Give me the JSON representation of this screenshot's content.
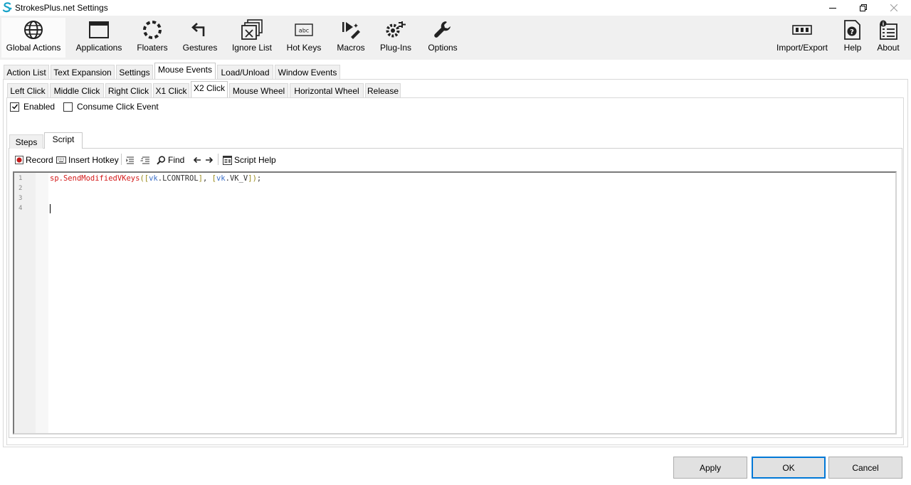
{
  "window": {
    "title": "StrokesPlus.net Settings"
  },
  "toolbar": {
    "global_actions": "Global Actions",
    "applications": "Applications",
    "floaters": "Floaters",
    "gestures": "Gestures",
    "ignore_list": "Ignore List",
    "hot_keys": "Hot Keys",
    "macros": "Macros",
    "plug_ins": "Plug-Ins",
    "options": "Options",
    "import_export": "Import/Export",
    "help": "Help",
    "about": "About",
    "hotkeys_icon_text": "abc"
  },
  "tabs": {
    "action_list": "Action List",
    "text_expansion": "Text Expansion",
    "settings": "Settings",
    "mouse_events": "Mouse Events",
    "load_unload": "Load/Unload",
    "window_events": "Window Events"
  },
  "mouse_tabs": {
    "left_click": "Left Click",
    "middle_click": "Middle Click",
    "right_click": "Right Click",
    "x1_click": "X1 Click",
    "x2_click": "X2 Click",
    "mouse_wheel": "Mouse Wheel",
    "horizontal_wheel": "Horizontal Wheel",
    "release": "Release"
  },
  "options": {
    "enabled_label": "Enabled",
    "enabled_checked": true,
    "consume_label": "Consume Click Event",
    "consume_checked": false
  },
  "editor_tabs": {
    "steps": "Steps",
    "script": "Script"
  },
  "script_toolbar": {
    "record": "Record",
    "insert_hotkey": "Insert Hotkey",
    "find": "Find",
    "script_help": "Script Help"
  },
  "editor": {
    "line_numbers": [
      "1",
      "2",
      "3",
      "4"
    ],
    "code": {
      "obj": "sp",
      "dot1": ".",
      "method": "SendModifiedVKeys",
      "open_paren": "(",
      "open_br1": "[",
      "vk1": "vk",
      "dot2": ".",
      "key1": "LCONTROL",
      "close_br1": "]",
      "comma": ", ",
      "open_br2": "[",
      "vk2": "vk",
      "dot3": ".",
      "key2": "VK_V",
      "close_br2": "]",
      "close_paren": ")",
      "semicolon": ";"
    }
  },
  "buttons": {
    "apply": "Apply",
    "ok": "OK",
    "cancel": "Cancel"
  },
  "colors": {
    "accent": "#0078d7",
    "code_red": "#d41a1a",
    "code_olive": "#9a8a1a",
    "code_blue": "#3a6ec8"
  }
}
